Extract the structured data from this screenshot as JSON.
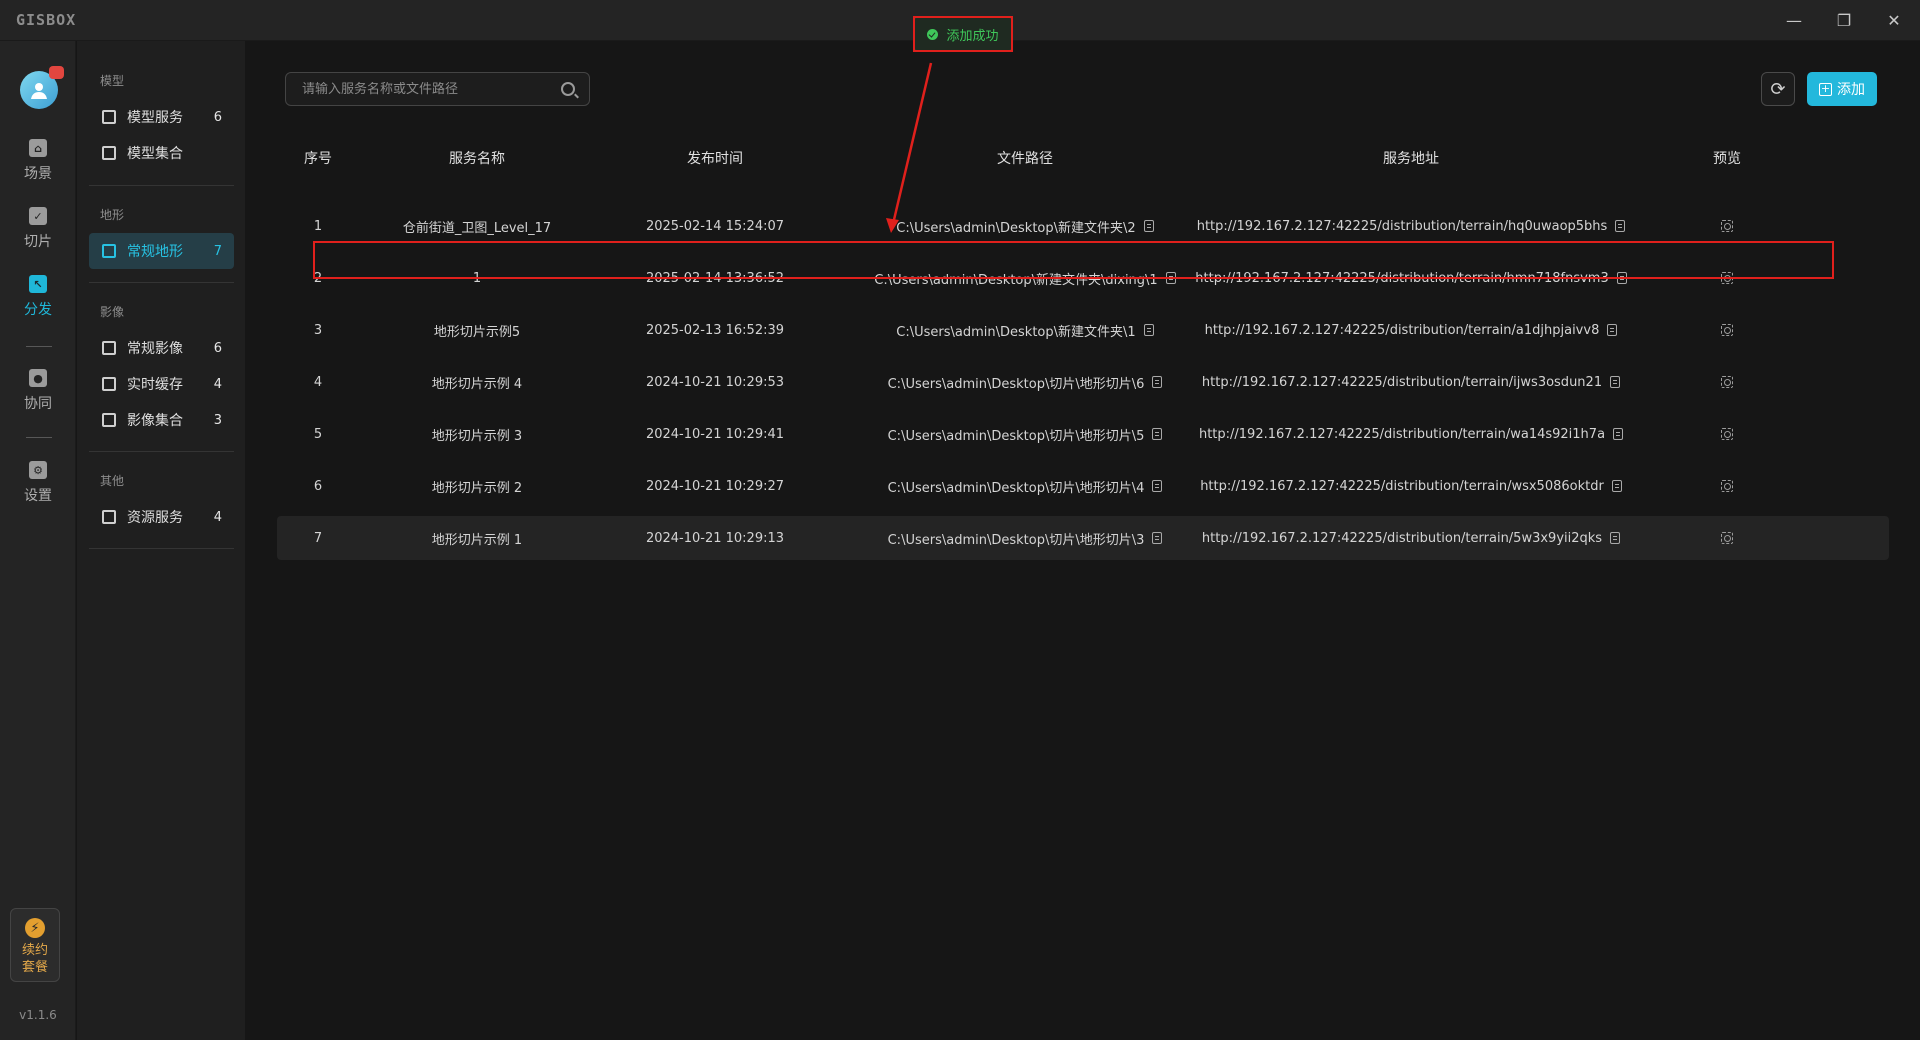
{
  "app": {
    "logo": "GISBOX",
    "version": "v1.1.6"
  },
  "window_controls": {
    "minimize": "—",
    "restore": "❐",
    "close": "✕"
  },
  "rail": {
    "items": [
      {
        "label": "场景"
      },
      {
        "label": "切片"
      },
      {
        "label": "分发",
        "active": true
      },
      {
        "label": "协同"
      },
      {
        "label": "设置"
      }
    ],
    "package_label": "续约套餐"
  },
  "sidebar": {
    "groups": [
      {
        "title": "模型",
        "items": [
          {
            "label": "模型服务",
            "count": "6"
          },
          {
            "label": "模型集合",
            "count": ""
          }
        ]
      },
      {
        "title": "地形",
        "items": [
          {
            "label": "常规地形",
            "count": "7",
            "active": true
          }
        ]
      },
      {
        "title": "影像",
        "items": [
          {
            "label": "常规影像",
            "count": "6"
          },
          {
            "label": "实时缓存",
            "count": "4"
          },
          {
            "label": "影像集合",
            "count": "3"
          }
        ]
      },
      {
        "title": "其他",
        "items": [
          {
            "label": "资源服务",
            "count": "4"
          }
        ]
      }
    ]
  },
  "toolbar": {
    "search_placeholder": "请输入服务名称或文件路径",
    "add_label": "添加"
  },
  "toast": {
    "text": "添加成功"
  },
  "table": {
    "headers": [
      "序号",
      "服务名称",
      "发布时间",
      "文件路径",
      "服务地址",
      "预览"
    ],
    "rows": [
      {
        "idx": "1",
        "name": "仓前街道_卫图_Level_17",
        "time": "2025-02-14 15:24:07",
        "path": "C:\\Users\\admin\\Desktop\\新建文件夹\\2",
        "url": "http://192.167.2.127:42225/distribution/terrain/hq0uwaop5bhs"
      },
      {
        "idx": "2",
        "name": "1",
        "time": "2025-02-14 13:36:52",
        "path": "C:\\Users\\admin\\Desktop\\新建文件夹\\dixing\\1",
        "url": "http://192.167.2.127:42225/distribution/terrain/hmn718fnsvm3"
      },
      {
        "idx": "3",
        "name": "地形切片示例5",
        "time": "2025-02-13 16:52:39",
        "path": "C:\\Users\\admin\\Desktop\\新建文件夹\\1",
        "url": "http://192.167.2.127:42225/distribution/terrain/a1djhpjaivv8"
      },
      {
        "idx": "4",
        "name": "地形切片示例 4",
        "time": "2024-10-21 10:29:53",
        "path": "C:\\Users\\admin\\Desktop\\切片\\地形切片\\6",
        "url": "http://192.167.2.127:42225/distribution/terrain/ijws3osdun21"
      },
      {
        "idx": "5",
        "name": "地形切片示例 3",
        "time": "2024-10-21 10:29:41",
        "path": "C:\\Users\\admin\\Desktop\\切片\\地形切片\\5",
        "url": "http://192.167.2.127:42225/distribution/terrain/wa14s92i1h7a"
      },
      {
        "idx": "6",
        "name": "地形切片示例 2",
        "time": "2024-10-21 10:29:27",
        "path": "C:\\Users\\admin\\Desktop\\切片\\地形切片\\4",
        "url": "http://192.167.2.127:42225/distribution/terrain/wsx5086oktdr"
      },
      {
        "idx": "7",
        "name": "地形切片示例 1",
        "time": "2024-10-21 10:29:13",
        "path": "C:\\Users\\admin\\Desktop\\切片\\地形切片\\3",
        "url": "http://192.167.2.127:42225/distribution/terrain/5w3x9yii2qks"
      }
    ]
  },
  "colors": {
    "accent": "#23b8dc",
    "success": "#3fc75a",
    "annotation_red": "#e0201c"
  }
}
